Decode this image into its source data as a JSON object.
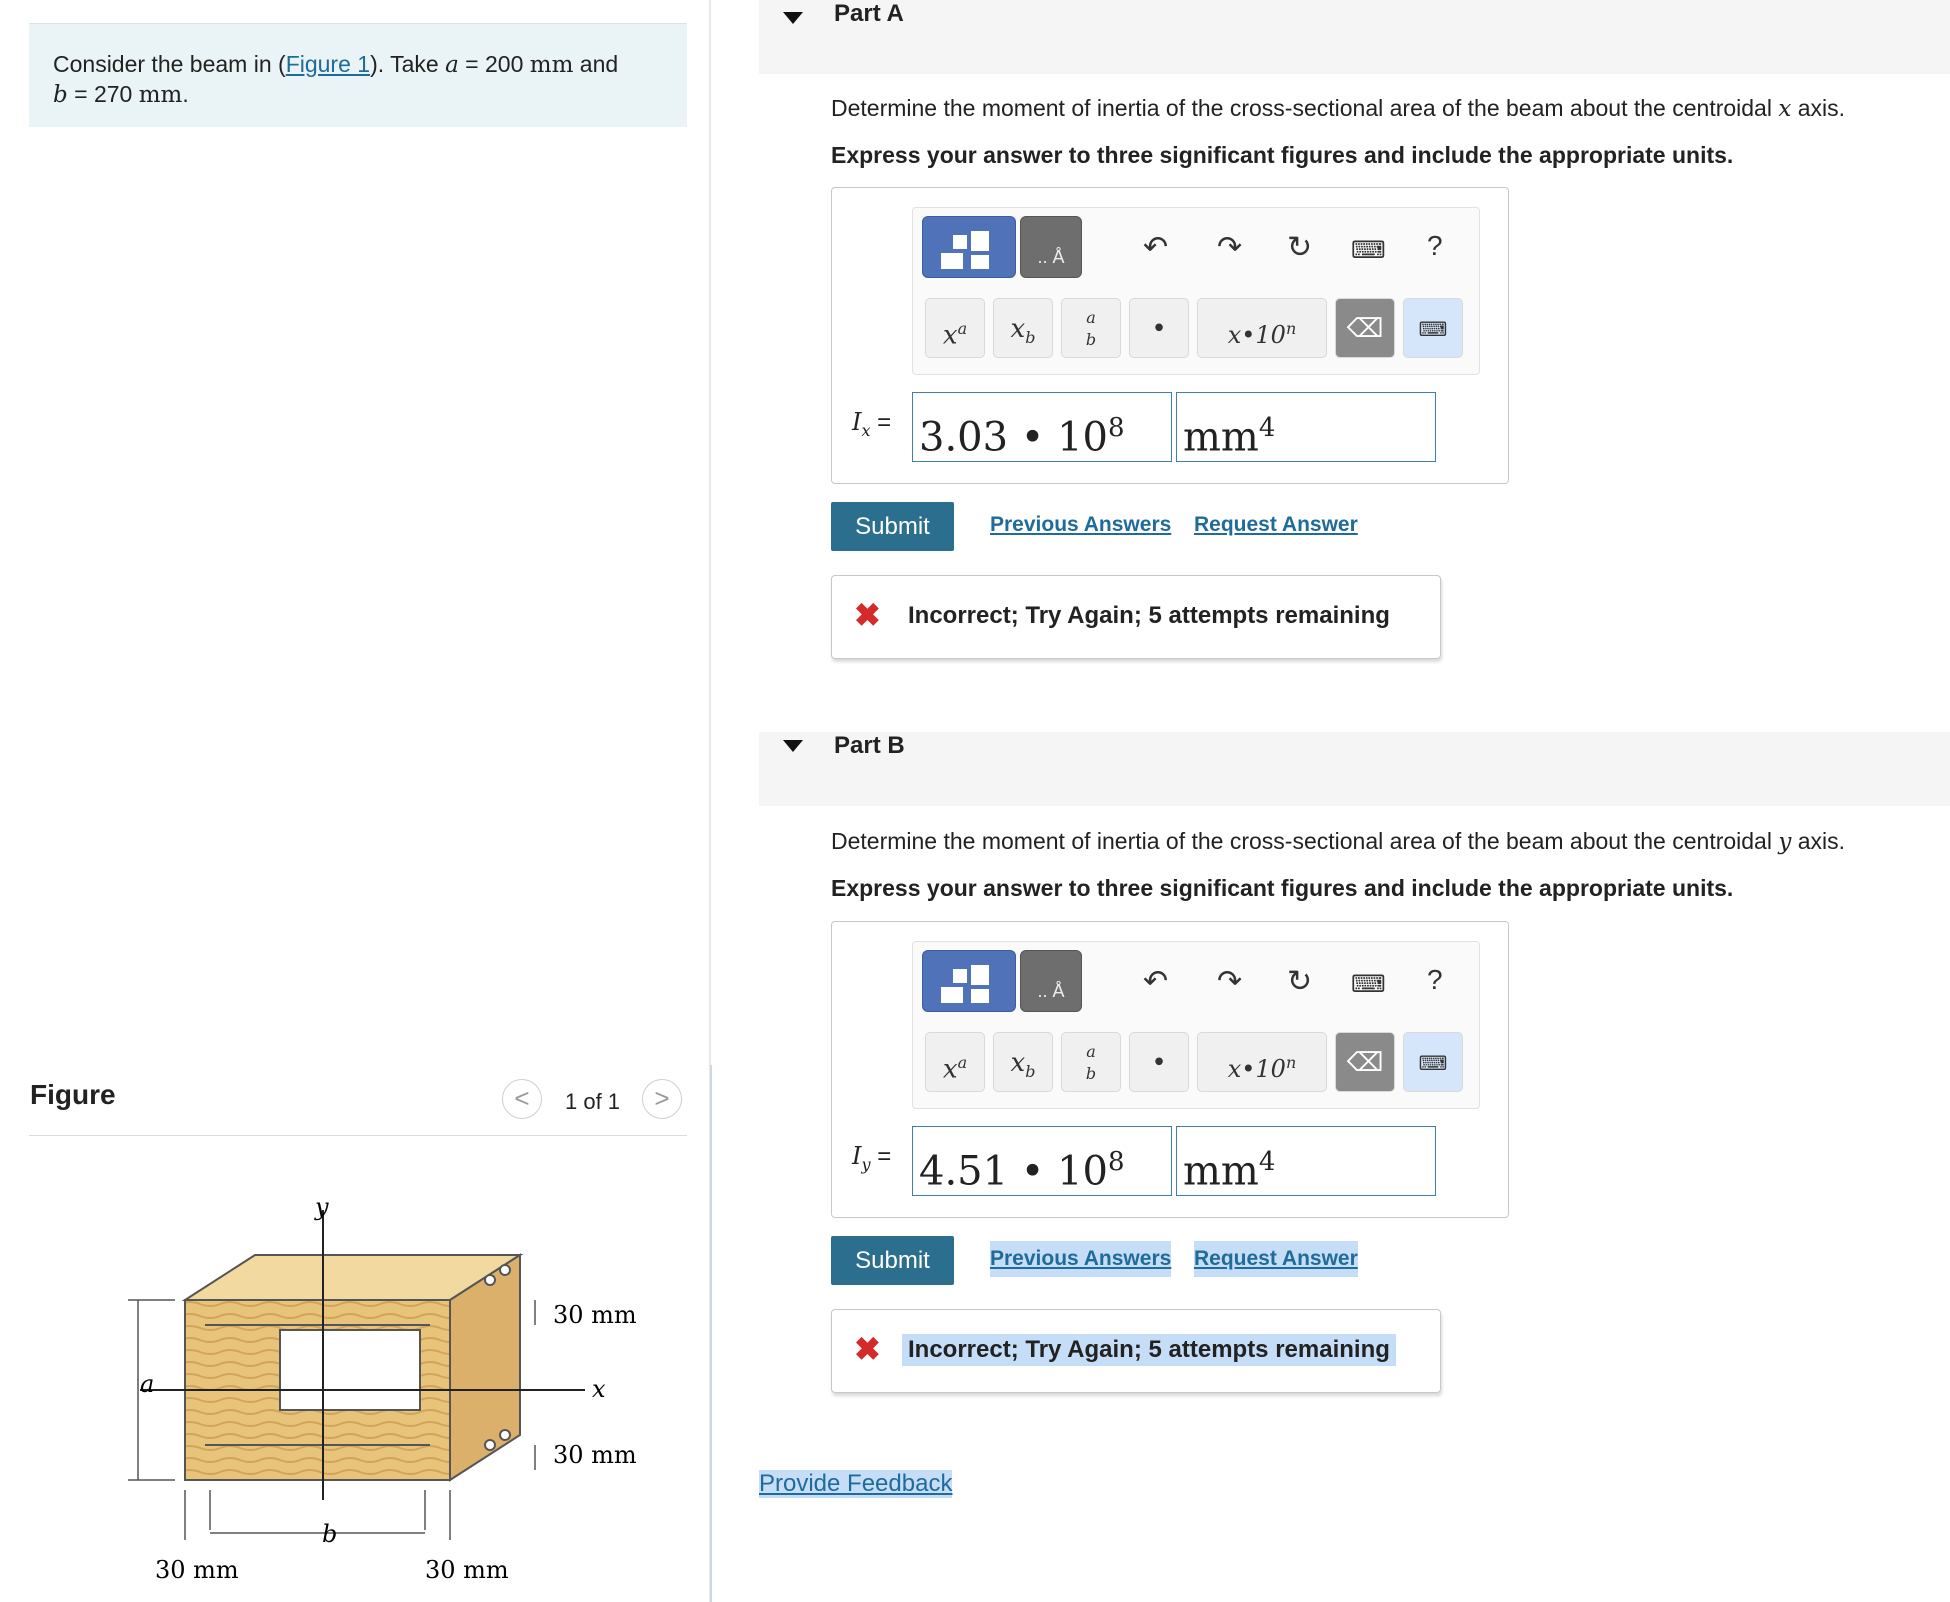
{
  "problem": {
    "prefix": "Consider the beam in (",
    "figure_link": "Figure 1",
    "mid": "). Take ",
    "var_a": "a",
    "eq1": " = 200 ",
    "unit1": "mm",
    "and": " and",
    "var_b": "b",
    "eq2": " = 270 ",
    "unit2": "mm",
    "end": "."
  },
  "figure": {
    "label": "Figure",
    "prev": "<",
    "next": ">",
    "count": "1 of 1",
    "labels": {
      "y": "y",
      "x": "x",
      "a": "a",
      "b": "b",
      "top_thk": "30 mm",
      "bot_thk": "30 mm",
      "left_w": "30 mm",
      "right_w": "30 mm"
    }
  },
  "parts": [
    {
      "title": "Part A",
      "question_prefix": "Determine the moment of inertia of the cross-sectional area of the beam about the centroidal ",
      "question_var": "x",
      "question_suffix": " axis.",
      "instruction": "Express your answer to three significant figures and include the appropriate units.",
      "label_main": "I",
      "label_sub": "x",
      "label_eq": " =",
      "value": "3.03 • 10",
      "value_exp": "8",
      "unit": "mm",
      "unit_exp": "4",
      "submit": "Submit",
      "prev_answers": "Previous Answers",
      "request_answer": "Request Answer",
      "feedback": "Incorrect; Try Again; 5 attempts remaining"
    },
    {
      "title": "Part B",
      "question_prefix": "Determine the moment of inertia of the cross-sectional area of the beam about the centroidal ",
      "question_var": "y",
      "question_suffix": " axis.",
      "instruction": "Express your answer to three significant figures and include the appropriate units.",
      "label_main": "I",
      "label_sub": "y",
      "label_eq": " =",
      "value": "4.51 • 10",
      "value_exp": "8",
      "unit": "mm",
      "unit_exp": "4",
      "submit": "Submit",
      "prev_answers": "Previous Answers",
      "request_answer": "Request Answer",
      "feedback": "Incorrect; Try Again; 5 attempts remaining"
    }
  ],
  "toolbar": {
    "help": "?",
    "key_power": "x",
    "key_power_sup": "a",
    "key_sub": "x",
    "key_sub_sub": "b",
    "key_frac_num": "a",
    "key_frac_den": "b",
    "key_sci": "x•10",
    "key_sci_sup": "n",
    "key_dot": "•"
  },
  "provide_feedback": "Provide Feedback"
}
